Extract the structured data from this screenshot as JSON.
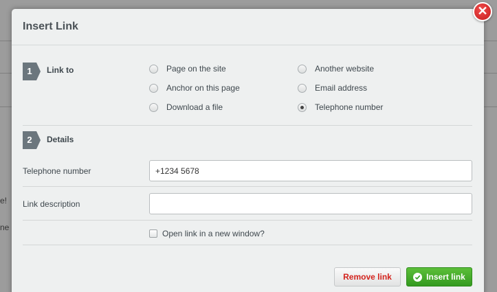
{
  "dialog": {
    "title": "Insert Link",
    "close_symbol": "✕"
  },
  "step1": {
    "number": "1",
    "label": "Link to",
    "options": [
      {
        "label": "Page on the site",
        "checked": false
      },
      {
        "label": "Another website",
        "checked": false
      },
      {
        "label": "Anchor on this page",
        "checked": false
      },
      {
        "label": "Email address",
        "checked": false
      },
      {
        "label": "Download a file",
        "checked": false
      },
      {
        "label": "Telephone number",
        "checked": true
      }
    ]
  },
  "step2": {
    "number": "2",
    "label": "Details",
    "telephone_label": "Telephone number",
    "telephone_value": "+1234 5678",
    "description_label": "Link description",
    "description_value": "",
    "new_window_label": "Open link in a new window?",
    "new_window_checked": false
  },
  "buttons": {
    "remove_label": "Remove link",
    "insert_label": "Insert link"
  },
  "background": {
    "fragments": [
      "e!",
      "ne"
    ]
  },
  "colors": {
    "badge": "#6b767d",
    "remove_text": "#d4231d",
    "insert_bg": "#3aa324",
    "close_bg": "#d42a2a"
  }
}
